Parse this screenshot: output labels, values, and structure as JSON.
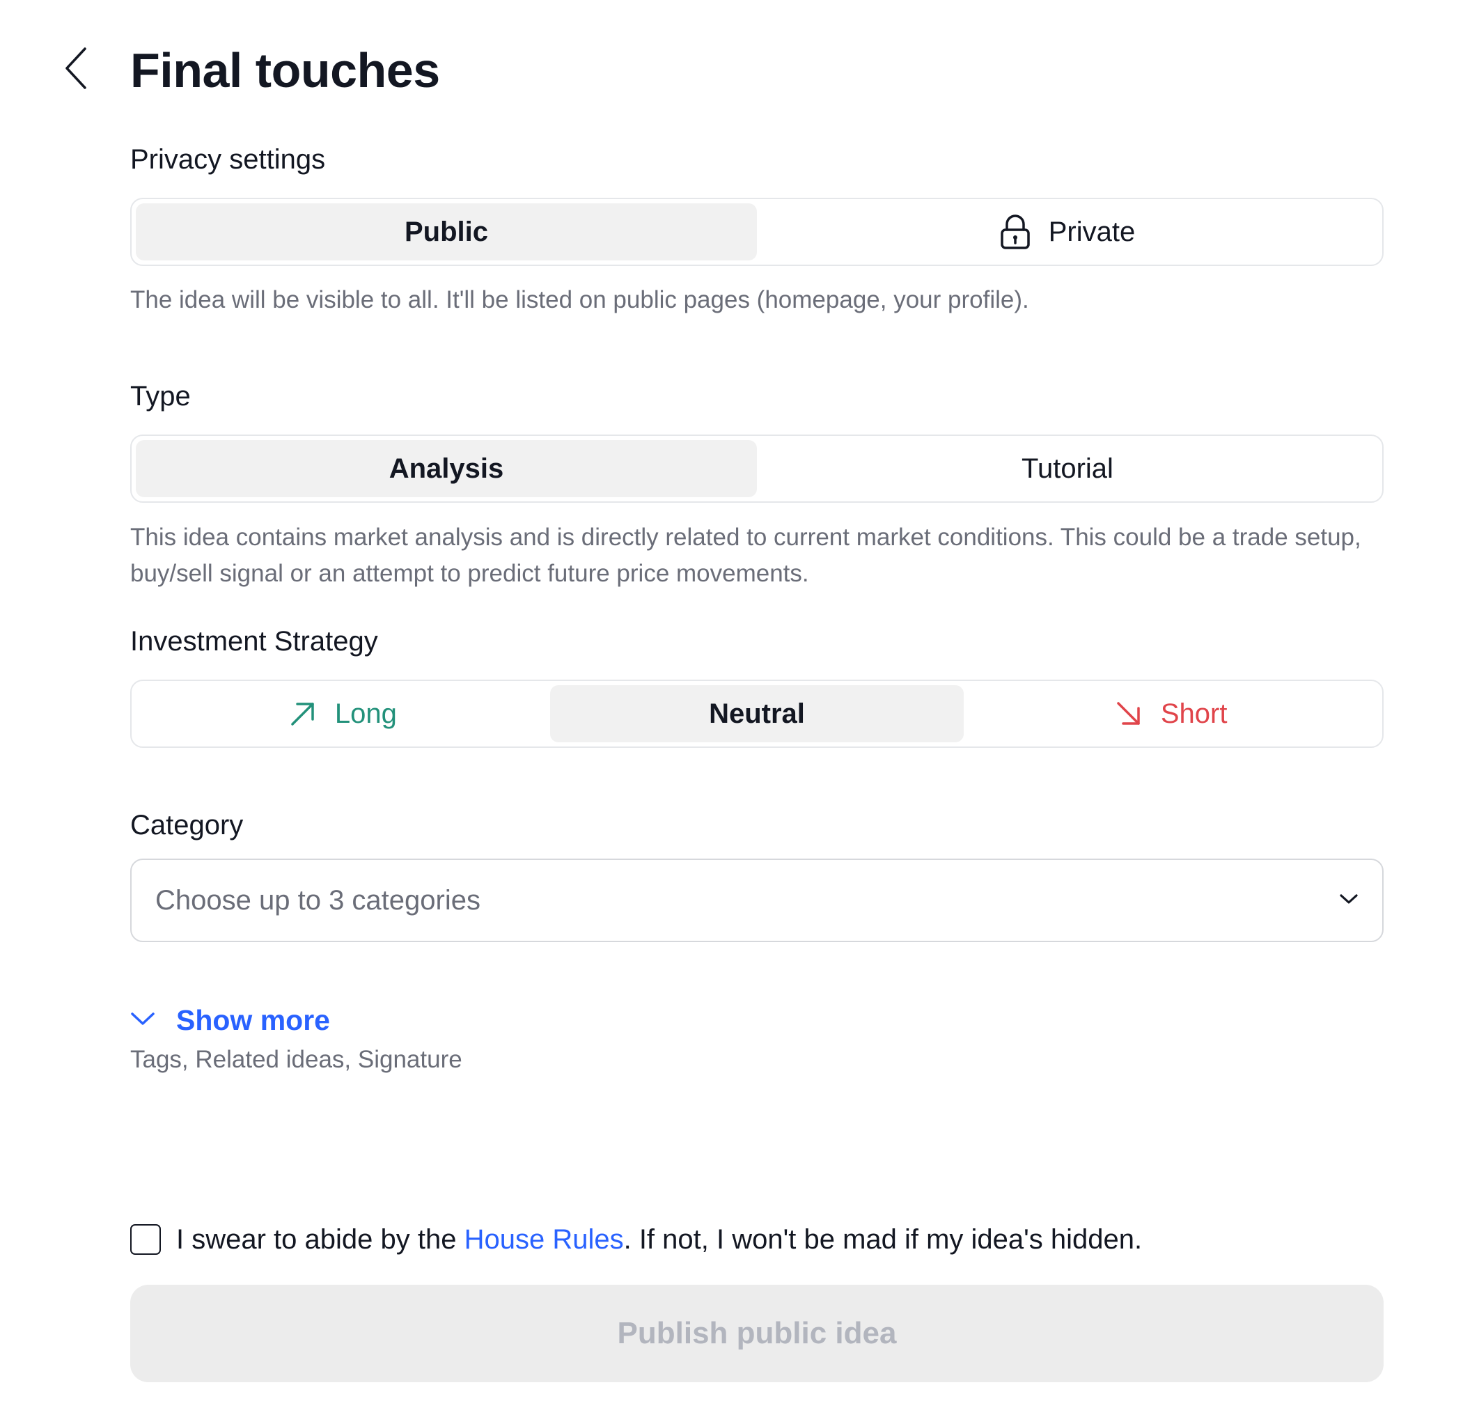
{
  "header": {
    "title": "Final touches"
  },
  "privacy": {
    "label": "Privacy settings",
    "options": [
      "Public",
      "Private"
    ],
    "selected": "Public",
    "help": "The idea will be visible to all. It'll be listed on public pages (homepage, your profile)."
  },
  "type": {
    "label": "Type",
    "options": [
      "Analysis",
      "Tutorial"
    ],
    "selected": "Analysis",
    "help": "This idea contains market analysis and is directly related to current market conditions. This could be a trade setup, buy/sell signal or an attempt to predict future price movements."
  },
  "strategy": {
    "label": "Investment Strategy",
    "options": [
      "Long",
      "Neutral",
      "Short"
    ],
    "selected": "Neutral",
    "colors": {
      "long": "#22917a",
      "short": "#e0444a"
    }
  },
  "category": {
    "label": "Category",
    "placeholder": "Choose up to 3 categories"
  },
  "show_more": {
    "label": "Show more",
    "subtitle": "Tags, Related ideas, Signature"
  },
  "agreement": {
    "prefix": "I swear to abide by the ",
    "link": "House Rules",
    "suffix": ". If not, I won't be mad if my idea's hidden.",
    "checked": false
  },
  "publish": {
    "label": "Publish public idea"
  },
  "icons": {
    "back": "chevron-left-icon",
    "lock": "lock-icon",
    "long": "arrow-up-right-icon",
    "short": "arrow-down-right-icon",
    "dropdown": "chevron-down-icon",
    "expand": "chevron-down-icon"
  },
  "colors": {
    "accent": "#2962ff",
    "text": "#131722",
    "muted": "#6a6d78",
    "active_segment": "#f1f1f1"
  }
}
